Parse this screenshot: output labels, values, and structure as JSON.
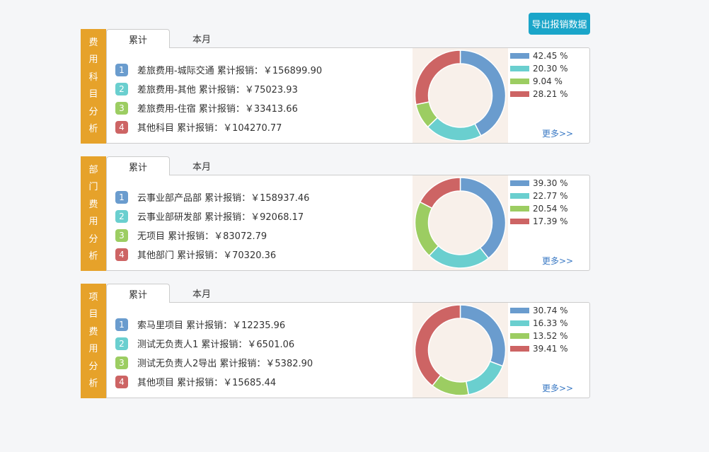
{
  "export_label": "导出报销数据",
  "colors": [
    "#6a9cce",
    "#6acfcf",
    "#9ccd62",
    "#cd6464"
  ],
  "panels": [
    {
      "side_title": [
        "费",
        "用",
        "科",
        "目",
        "分",
        "析"
      ],
      "tab_cumulative": "累计",
      "tab_month": "本月",
      "items": [
        {
          "num": "1",
          "text": "差旅费用-城际交通 累计报销：￥156899.90"
        },
        {
          "num": "2",
          "text": "差旅费用-其他 累计报销：￥75023.93"
        },
        {
          "num": "3",
          "text": "差旅费用-住宿 累计报销：￥33413.66"
        },
        {
          "num": "4",
          "text": "其他科目 累计报销：￥104270.77"
        }
      ],
      "percents": [
        "42.45 %",
        "20.30 %",
        "9.04 %",
        "28.21 %"
      ],
      "chart_data": {
        "type": "pie",
        "values": [
          42.45,
          20.3,
          9.04,
          28.21
        ],
        "labels": [
          "42.45 %",
          "20.30 %",
          "9.04 %",
          "28.21 %"
        ]
      },
      "more": "更多>>"
    },
    {
      "side_title": [
        "部",
        "门",
        "费",
        "用",
        "分",
        "析"
      ],
      "tab_cumulative": "累计",
      "tab_month": "本月",
      "items": [
        {
          "num": "1",
          "text": "云事业部产品部 累计报销：￥158937.46"
        },
        {
          "num": "2",
          "text": "云事业部研发部 累计报销：￥92068.17"
        },
        {
          "num": "3",
          "text": "无项目 累计报销：￥83072.79"
        },
        {
          "num": "4",
          "text": "其他部门 累计报销：￥70320.36"
        }
      ],
      "percents": [
        "39.30 %",
        "22.77 %",
        "20.54 %",
        "17.39 %"
      ],
      "chart_data": {
        "type": "pie",
        "values": [
          39.3,
          22.77,
          20.54,
          17.39
        ],
        "labels": [
          "39.30 %",
          "22.77 %",
          "20.54 %",
          "17.39 %"
        ]
      },
      "more": "更多>>"
    },
    {
      "side_title": [
        "项",
        "目",
        "费",
        "用",
        "分",
        "析"
      ],
      "tab_cumulative": "累计",
      "tab_month": "本月",
      "items": [
        {
          "num": "1",
          "text": "索马里项目 累计报销：￥12235.96"
        },
        {
          "num": "2",
          "text": "测试无负责人1 累计报销：￥6501.06"
        },
        {
          "num": "3",
          "text": "测试无负责人2导出 累计报销：￥5382.90"
        },
        {
          "num": "4",
          "text": "其他项目 累计报销：￥15685.44"
        }
      ],
      "percents": [
        "30.74 %",
        "16.33 %",
        "13.52 %",
        "39.41 %"
      ],
      "chart_data": {
        "type": "pie",
        "values": [
          30.74,
          16.33,
          13.52,
          39.41
        ],
        "labels": [
          "30.74 %",
          "16.33 %",
          "13.52 %",
          "39.41 %"
        ]
      },
      "more": "更多>>"
    }
  ]
}
